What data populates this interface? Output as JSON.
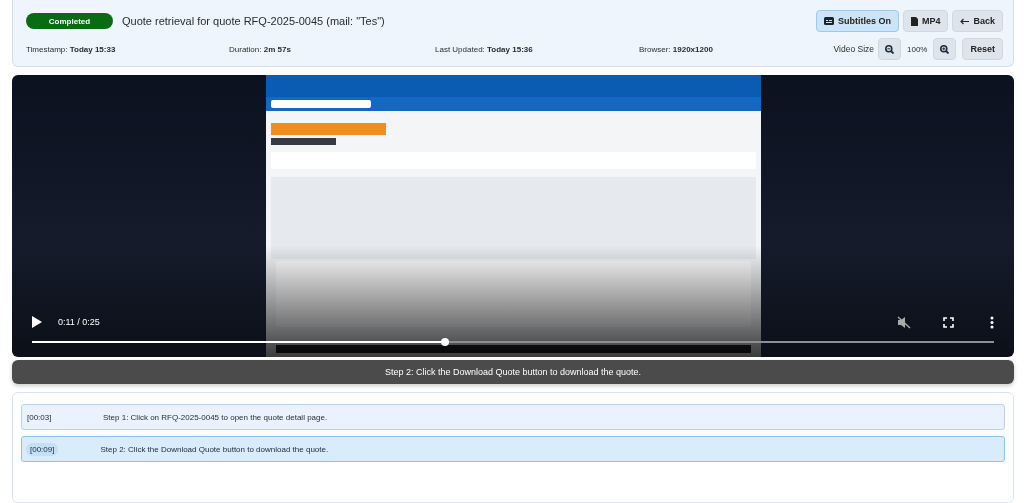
{
  "header": {
    "status": "Completed",
    "title": "Quote retrieval for quote RFQ-2025-0045 (mail: \"Tes\")",
    "buttons": [
      {
        "kind": "subtitles",
        "label": "Subtitles On",
        "on": true
      },
      {
        "kind": "file",
        "label": "MP4",
        "on": false
      },
      {
        "kind": "back",
        "label": "Back",
        "on": false
      }
    ],
    "meta": [
      {
        "label": "Timestamp:",
        "value": "Today 15:33"
      },
      {
        "label": "Duration:",
        "value": "2m 57s"
      },
      {
        "label": "Last Updated:",
        "value": "Today 15:36"
      },
      {
        "label": "Browser:",
        "value": "1920x1200"
      }
    ],
    "video_size": {
      "label": "Video Size",
      "zoom": "100%",
      "reset": "Reset"
    }
  },
  "video": {
    "kind": "picture",
    "time": "0:11 / 0:25",
    "level": 0.429
  },
  "subtitle": "Step 2: Click the Download Quote button to download the quote.",
  "steps": [
    {
      "time": "[00:03]",
      "text": "Step 1: Click on RFQ-2025-0045 to open the quote detail page.",
      "selected": false
    },
    {
      "time": "[00:09]",
      "text": "Step 2: Click the Download Quote button to download the quote.",
      "selected": true
    }
  ]
}
